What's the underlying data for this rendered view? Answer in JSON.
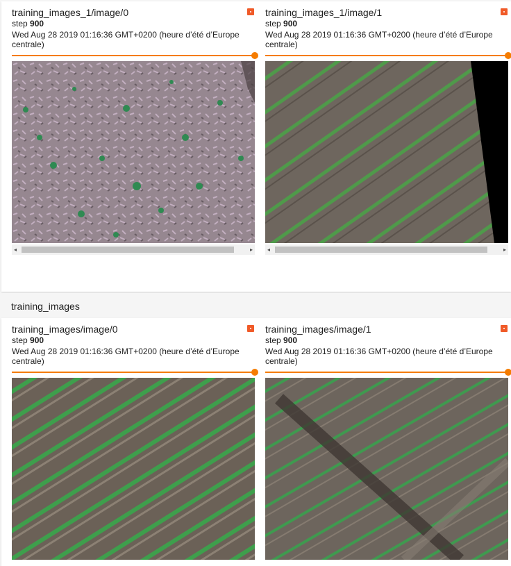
{
  "group_title": "training_images",
  "cards": [
    {
      "title": "training_images_1/image/0",
      "step_label": "step",
      "step": "900",
      "timestamp": "Wed Aug 28 2019 01:16:36 GMT+0200 (heure d’été d’Europe centrale)"
    },
    {
      "title": "training_images_1/image/1",
      "step_label": "step",
      "step": "900",
      "timestamp": "Wed Aug 28 2019 01:16:36 GMT+0200 (heure d’été d’Europe centrale)"
    },
    {
      "title": "training_images/image/0",
      "step_label": "step",
      "step": "900",
      "timestamp": "Wed Aug 28 2019 01:16:36 GMT+0200 (heure d’été d’Europe centrale)"
    },
    {
      "title": "training_images/image/1",
      "step_label": "step",
      "step": "900",
      "timestamp": "Wed Aug 28 2019 01:16:36 GMT+0200 (heure d’été d’Europe centrale)"
    }
  ],
  "colors": {
    "accent": "#f57c00",
    "pin": "#f05a28",
    "crop_green": "#2e9e43",
    "soil": "#6b5f55"
  },
  "scrollbar": {
    "left_arrow": "◂",
    "right_arrow": "▸"
  }
}
